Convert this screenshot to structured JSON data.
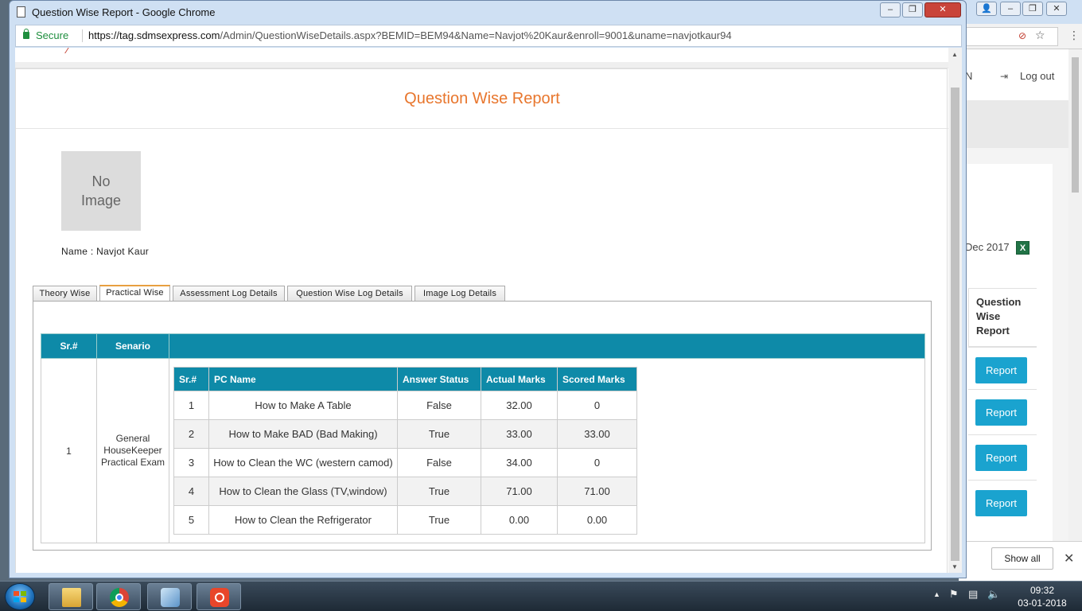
{
  "popup": {
    "title": "Question Wise Report - Google Chrome",
    "security_label": "Secure",
    "url_scheme_host": "https://tag.sdmsexpress.com",
    "url_path": "/Admin/QuestionWiseDetails.aspx?BEMID=BEM94&Name=Navjot%20Kaur&enroll=9001&uname=navjotkaur94"
  },
  "report": {
    "title": "Question Wise Report",
    "no_image_line1": "No",
    "no_image_line2": "Image",
    "name_label": "Name : Navjot Kaur",
    "tabs": [
      {
        "label": "Theory Wise"
      },
      {
        "label": "Practical Wise"
      },
      {
        "label": "Assessment Log Details"
      },
      {
        "label": "Question Wise Log Details"
      },
      {
        "label": "Image Log Details"
      }
    ],
    "active_tab": "Practical Wise",
    "outer_headers": {
      "sr": "Sr.#",
      "scenario": "Senario"
    },
    "scenario_row": {
      "sr": "1",
      "scenario": "General HouseKeeper Practical Exam"
    },
    "inner_headers": [
      "Sr.#",
      "PC Name",
      "Answer Status",
      "Actual Marks",
      "Scored Marks"
    ],
    "rows": [
      {
        "sr": "1",
        "pc_name": "How to Make A Table",
        "status": "False",
        "actual": "32.00",
        "scored": "0"
      },
      {
        "sr": "2",
        "pc_name": "How to Make BAD (Bad Making)",
        "status": "True",
        "actual": "33.00",
        "scored": "33.00"
      },
      {
        "sr": "3",
        "pc_name": "How to Clean the WC (western camod)",
        "status": "False",
        "actual": "34.00",
        "scored": "0"
      },
      {
        "sr": "4",
        "pc_name": "How to Clean the Glass (TV,window)",
        "status": "True",
        "actual": "71.00",
        "scored": "71.00"
      },
      {
        "sr": "5",
        "pc_name": "How to Clean the Refrigerator",
        "status": "True",
        "actual": "0.00",
        "scored": "0.00"
      }
    ]
  },
  "background_page": {
    "header_fragment": "N",
    "logout_label": "Log out",
    "date_fragment": "Dec 2017",
    "column_header": "Question Wise Report",
    "report_buttons": [
      "Report",
      "Report",
      "Report",
      "Report"
    ],
    "download_show_all": "Show all"
  },
  "taskbar": {
    "time": "09:32",
    "date": "03-01-2018"
  },
  "colors": {
    "accent_title": "#e8762d",
    "table_header": "#0e8aa8",
    "report_button": "#1aa3cf",
    "secure_green": "#1e8e3e"
  }
}
